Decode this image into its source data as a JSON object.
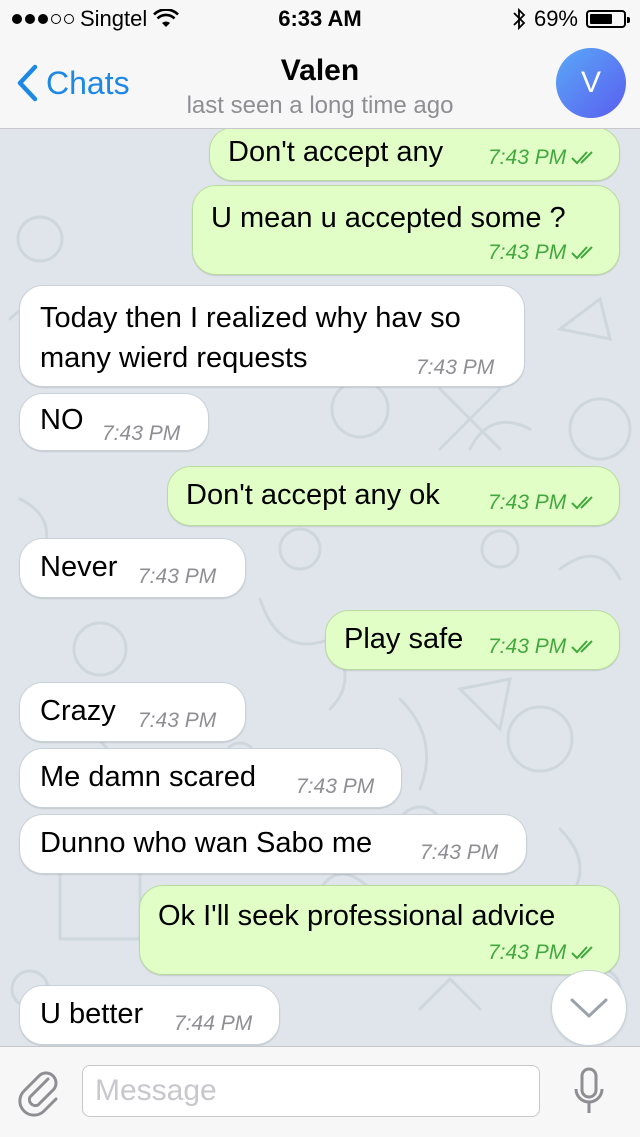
{
  "status_bar": {
    "carrier": "Singtel",
    "time": "6:33 AM",
    "battery": "69%",
    "battery_level": 0.69
  },
  "header": {
    "back_label": "Chats",
    "contact_name": "Valen",
    "status": "last seen a long time ago",
    "avatar_initial": "V"
  },
  "messages": [
    {
      "dir": "out",
      "text": "Don't accept any",
      "time": "7:43 PM",
      "read": true
    },
    {
      "dir": "out",
      "text": "U mean u accepted some ?",
      "time": "7:43 PM",
      "read": true
    },
    {
      "dir": "in",
      "text": "Today then I realized why hav so many wierd requests",
      "time": "7:43 PM"
    },
    {
      "dir": "in",
      "text": "NO",
      "time": "7:43 PM"
    },
    {
      "dir": "out",
      "text": "Don't accept any ok",
      "time": "7:43 PM",
      "read": true
    },
    {
      "dir": "in",
      "text": "Never",
      "time": "7:43 PM"
    },
    {
      "dir": "out",
      "text": "Play safe",
      "time": "7:43 PM",
      "read": true
    },
    {
      "dir": "in",
      "text": "Crazy",
      "time": "7:43 PM"
    },
    {
      "dir": "in",
      "text": "Me damn scared",
      "time": "7:43 PM"
    },
    {
      "dir": "in",
      "text": "Dunno who wan Sabo me",
      "time": "7:43 PM"
    },
    {
      "dir": "out",
      "text": "Ok I'll seek professional advice",
      "time": "7:43 PM",
      "read": true
    },
    {
      "dir": "in",
      "text": "U better",
      "time": "7:44 PM"
    }
  ],
  "input": {
    "placeholder": "Message"
  },
  "colors": {
    "accent": "#1e88e5",
    "outgoing_bubble": "#e1fec6",
    "incoming_bubble": "#ffffff",
    "chat_background": "#dfe5ea",
    "read_check": "#42a83e"
  },
  "icons": [
    "signal-dots-icon",
    "wifi-icon",
    "bluetooth-icon",
    "battery-icon",
    "chevron-left-icon",
    "double-check-icon",
    "chevron-down-icon",
    "paperclip-icon",
    "microphone-icon"
  ]
}
